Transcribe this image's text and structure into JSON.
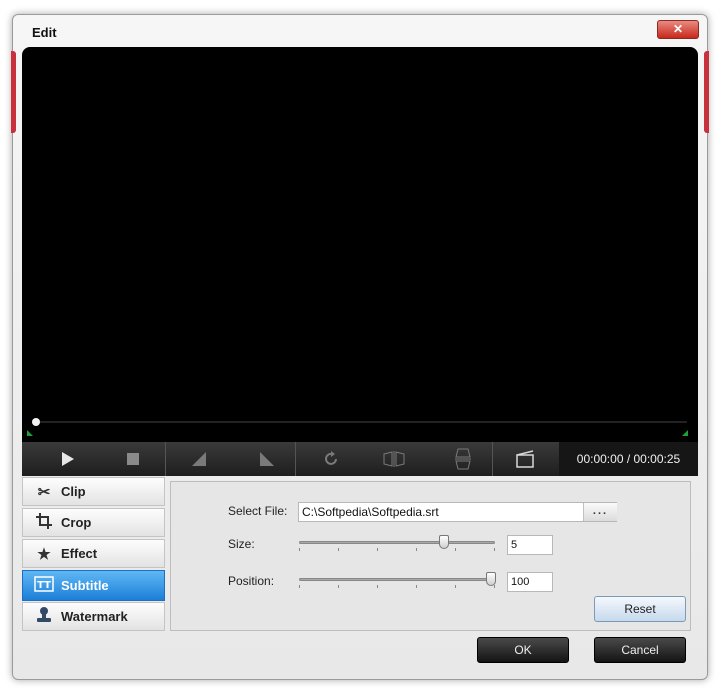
{
  "window": {
    "title": "Edit",
    "close_glyph": "✕"
  },
  "player": {
    "time_display": "00:00:00 / 00:00:25",
    "progress": 0
  },
  "controls": {
    "icons": [
      "play-icon",
      "stop-icon",
      "rotate-left-corner-icon",
      "rotate-right-corner-icon",
      "rotate-icon",
      "flip-horizontal-icon",
      "flip-vertical-icon",
      "snapshot-icon"
    ]
  },
  "tabs": [
    {
      "label": "Clip",
      "icon": "scissors-icon"
    },
    {
      "label": "Crop",
      "icon": "crop-icon"
    },
    {
      "label": "Effect",
      "icon": "star-icon"
    },
    {
      "label": "Subtitle",
      "icon": "subtitle-icon",
      "active": true
    },
    {
      "label": "Watermark",
      "icon": "stamp-icon"
    }
  ],
  "subtitle_panel": {
    "select_file_label": "Select File:",
    "file_path": "C:\\Softpedia\\Softpedia.srt",
    "browse_label": "...",
    "size_label": "Size:",
    "size_value": "5",
    "position_label": "Position:",
    "position_value": "100",
    "reset_label": "Reset"
  },
  "footer": {
    "ok_label": "OK",
    "cancel_label": "Cancel"
  },
  "colors": {
    "accent": "#c8303c",
    "active_tab": "#1c7ed8"
  }
}
